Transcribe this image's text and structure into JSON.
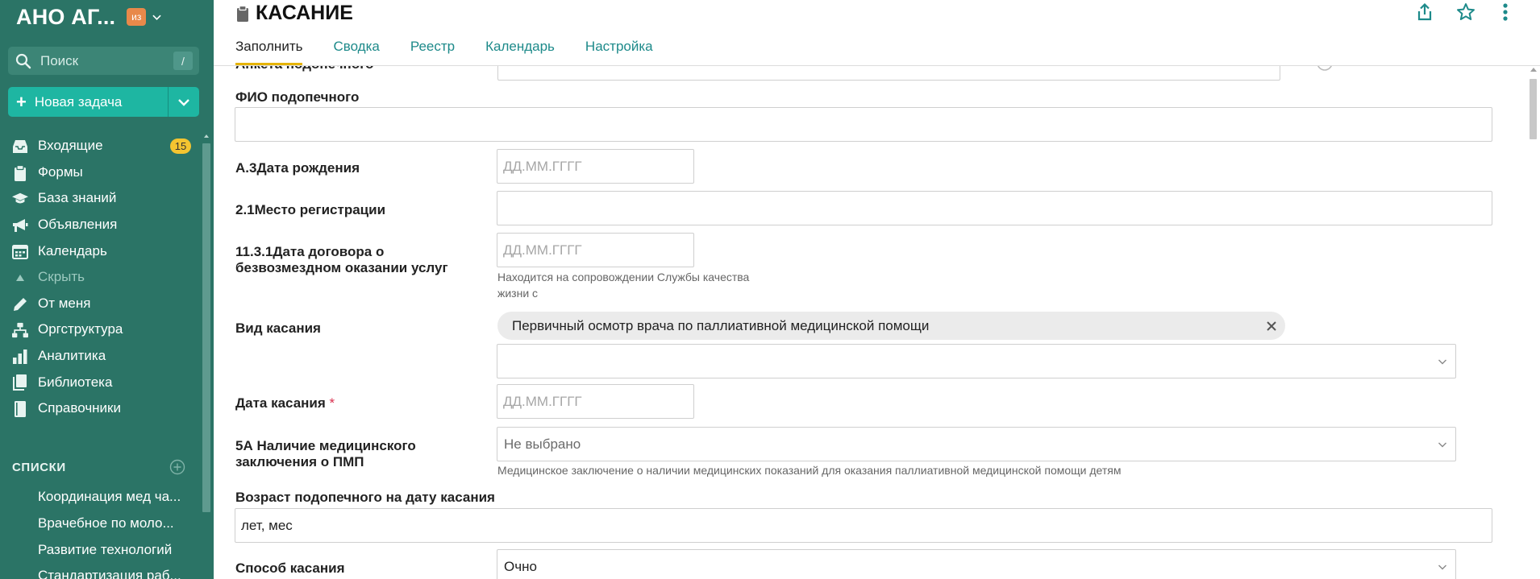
{
  "sidebar": {
    "org_name": "АНО АГ...",
    "org_badge": "из",
    "search_placeholder": "Поиск",
    "search_shortcut": "/",
    "new_task_label": "Новая задача",
    "nav": [
      {
        "label": "Входящие",
        "icon": "inbox-icon",
        "count": "15"
      },
      {
        "label": "Формы",
        "icon": "clipboard-icon"
      },
      {
        "label": "База знаний",
        "icon": "graduation-cap-icon"
      },
      {
        "label": "Объявления",
        "icon": "megaphone-icon"
      },
      {
        "label": "Календарь",
        "icon": "calendar-icon"
      },
      {
        "label": "Скрыть",
        "icon": "collapse-arrow-icon"
      },
      {
        "label": "От меня",
        "icon": "pencil-icon"
      },
      {
        "label": "Оргструктура",
        "icon": "org-structure-icon"
      },
      {
        "label": "Аналитика",
        "icon": "bar-chart-icon"
      },
      {
        "label": "Библиотека",
        "icon": "library-icon"
      },
      {
        "label": "Справочники",
        "icon": "book-icon"
      }
    ],
    "lists_heading": "СПИСКИ",
    "lists": [
      "Координация мед ча...",
      "Врачебное по моло...",
      "Развитие технологий",
      "Стандартизация раб..."
    ],
    "colors": {
      "background": "#2b7466",
      "new_task": "#1eb6a2",
      "badge": "#f4c430",
      "org_badge": "#e8894a"
    }
  },
  "header": {
    "title": "КАСАНИЕ",
    "title_icon": "clipboard-icon",
    "actions": [
      "share-icon",
      "star-icon",
      "more-vertical-icon"
    ],
    "tabs": [
      {
        "label": "Заполнить",
        "active": true
      },
      {
        "label": "Сводка",
        "active": false
      },
      {
        "label": "Реестр",
        "active": false
      },
      {
        "label": "Календарь",
        "active": false
      },
      {
        "label": "Настройка",
        "active": false
      }
    ],
    "accent": "#1d8a8a"
  },
  "form": {
    "cut_label": "Анкета подопечного",
    "fio_label": "ФИО подопечного",
    "fio_value": "",
    "birth_label": "А.3Дата рождения",
    "birth_placeholder": "ДД.ММ.ГГГГ",
    "reg_label": "2.1Место регистрации",
    "reg_value": "",
    "contract_label_1": "11.3.1Дата договора о",
    "contract_label_2": "безвозмездном оказании услуг",
    "contract_placeholder": "ДД.ММ.ГГГГ",
    "contract_hint_1": "Находится на сопровождении Службы качества",
    "contract_hint_2": "жизни с",
    "type_label": "Вид касания",
    "type_chip": "Первичный осмотр врача по паллиативной медицинской помощи",
    "type_select_value": "",
    "date_label": "Дата касания",
    "date_required": "*",
    "date_placeholder": "ДД.ММ.ГГГГ",
    "pmp_label_1": "5А Наличие медицинского",
    "pmp_label_2": "заключения о ПМП",
    "pmp_value": "Не выбрано",
    "pmp_hint": "Медицинское заключение о наличии медицинских показаний для оказания паллиативной медицинской помощи детям",
    "age_label": "Возраст подопечного на дату касания",
    "age_value": "лет, мес",
    "method_label": "Способ касания",
    "method_value": "Очно",
    "required_color": "#d9304f"
  }
}
